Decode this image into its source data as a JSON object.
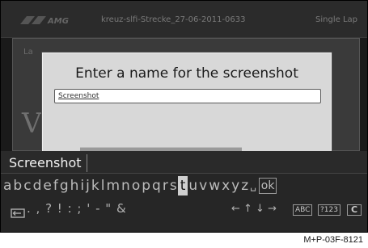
{
  "background_app": {
    "file_name": "kreuz-slfi-Strecke_27-06-2011-0633",
    "mode": "Single Lap",
    "lap_label": "La"
  },
  "dialog": {
    "title": "Enter a name for the screenshot",
    "input_value": "Screenshot"
  },
  "keyboard": {
    "candidate": "Screenshot",
    "letters_before": [
      "a",
      "b",
      "c",
      "d",
      "e",
      "f",
      "g",
      "h",
      "i",
      "j",
      "k",
      "l",
      "m",
      "n",
      "o",
      "p",
      "q",
      "r",
      "s"
    ],
    "active_letter": "t",
    "letters_after": [
      "u",
      "v",
      "w",
      "x",
      "y",
      "z"
    ],
    "space_key": "␣",
    "ok_key": "ok",
    "punctuation": ". , ? ! : ; ' - \" &",
    "arrows": "← ↑ ↓ →",
    "abc_key": "ABC",
    "num_key": "?123",
    "clear_key": "C"
  },
  "caption": "M+P-03F-8121"
}
